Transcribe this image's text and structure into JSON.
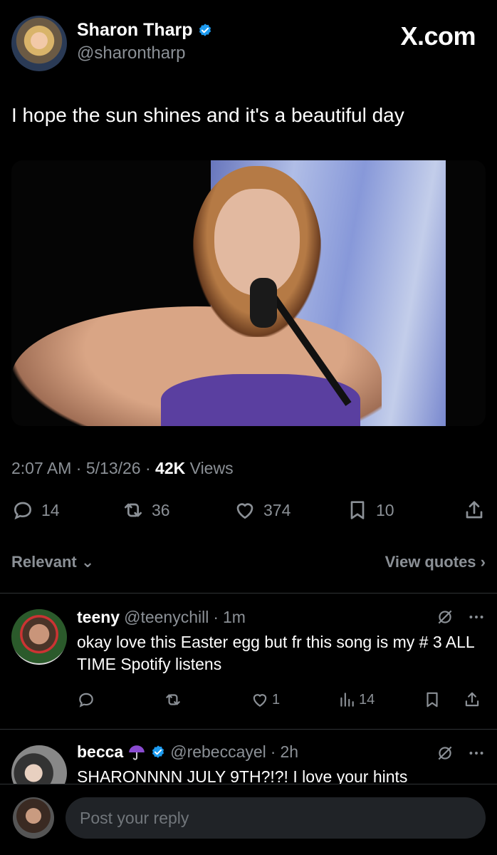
{
  "author": {
    "name": "Sharon Tharp",
    "handle": "@sharontharp"
  },
  "brand": "X.com",
  "tweet": {
    "text": "I hope the sun shines and it's a beautiful day",
    "time": "2:07 AM",
    "date": "5/13/26",
    "views_count": "42K",
    "views_label": "Views"
  },
  "actions": {
    "replies": "14",
    "reposts": "36",
    "likes": "374",
    "bookmarks": "10"
  },
  "filters": {
    "sort": "Relevant",
    "quotes": "View quotes"
  },
  "replies": [
    {
      "name": "teeny",
      "handle": "@teenychill",
      "time": "1m",
      "text": "okay love this Easter egg but fr this song is my # 3 ALL TIME Spotify listens",
      "likes": "1",
      "views": "14"
    },
    {
      "name": "becca",
      "handle": "@rebeccayel",
      "time": "2h",
      "text": "SHARONNNN JULY 9TH?!?! I love your hints"
    }
  ],
  "composer": {
    "placeholder": "Post your reply"
  },
  "colors": {
    "background": "#000000",
    "text": "#e7e9ea",
    "muted": "#8b9096",
    "verified": "#1d9bf0",
    "divider": "#2f3336"
  }
}
